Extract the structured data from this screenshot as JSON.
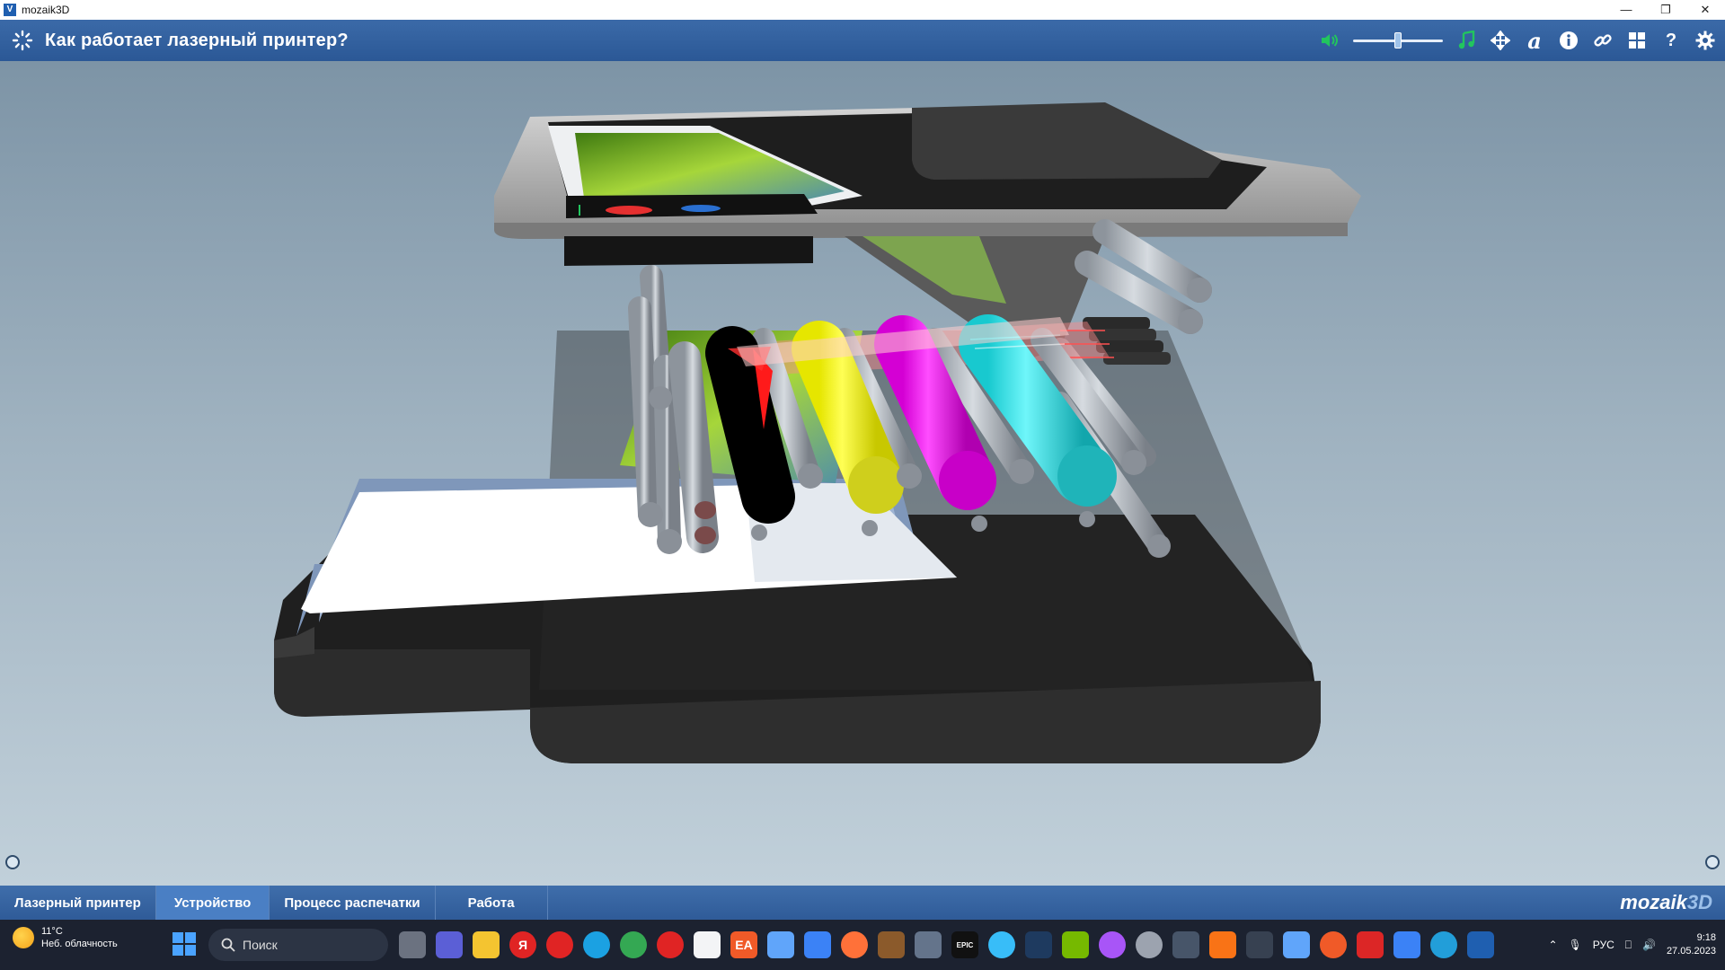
{
  "window": {
    "title": "mozaik3D",
    "minimize": "—",
    "restore": "❐",
    "close": "✕"
  },
  "header": {
    "title": "Как работает лазерный принтер?",
    "volume_level": 0.5,
    "tools": {
      "font": "a",
      "info": "i",
      "help": "?"
    }
  },
  "nav": {
    "tabs": [
      {
        "label": "Лазерный принтер",
        "active": false
      },
      {
        "label": "Устройство",
        "active": true
      },
      {
        "label": "Процесс распечатки",
        "active": false
      },
      {
        "label": "Работа",
        "active": false
      }
    ],
    "brand": "mozaik",
    "brand_3d": "3D"
  },
  "taskbar": {
    "weather_temp": "11°C",
    "weather_desc": "Неб. облачность",
    "search_placeholder": "Поиск",
    "language": "РУС",
    "time": "9:18",
    "date": "27.05.2023",
    "icon_labels": {
      "yandex": "Я",
      "epic": "EPIC",
      "ea": "EA"
    }
  },
  "colors": {
    "header": "#2f5b98",
    "accent_green": "#22c55e",
    "toner_black": "#000000",
    "toner_yellow": "#ffff1a",
    "toner_magenta": "#ff1aff",
    "toner_cyan": "#22e8ee"
  }
}
